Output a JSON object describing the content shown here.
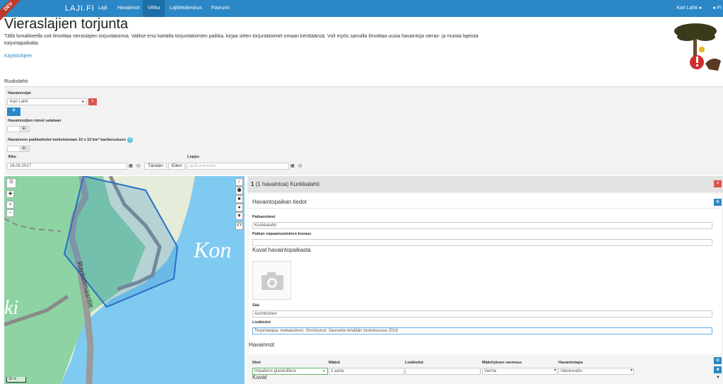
{
  "navbar": {
    "dev_label": "DEV",
    "brand": "LAJI.FI",
    "items": [
      {
        "label": "Lajit"
      },
      {
        "label": "Havainnot"
      },
      {
        "label": "Vihko"
      },
      {
        "label": "Lajitietokeskus"
      },
      {
        "label": "Foorumi"
      }
    ],
    "user": "Kari Lahti",
    "lang": "FI",
    "bg_color": "#2b87c6"
  },
  "page": {
    "title": "Vieraslajien torjunta",
    "intro": "Tällä lomakkeella voit ilmoittaa vieraslajien torjuntatoimia. Valitse ensi kartalta torjuntatoimien paikka, kirjaa sitten torjuntatoimet omaan kenttäänsä. Voit myös samalla ilmoittaa uusia havaintoja vieras- ja muista lajeista torjuntapaikalta.",
    "instructions_link": "Käyttöohjeet",
    "section": "Ruokolahti"
  },
  "form": {
    "observers_label": "Havainnoijat",
    "observer_value": "Kari Lahti",
    "hide_names_label": "Havainnoijien nimet salataan",
    "hide_names_value": "Ei",
    "coarse_label": "Havainnon paikkatiedot karkeistetaan 10 x 10 km² karttaruutuun",
    "coarse_value": "Ei",
    "start_label": "Alku",
    "start_value": "26.06.2017",
    "end_label": "Loppu",
    "end_placeholder": "pp.kk.vvvv tt.mm",
    "today_btn": "Tänään",
    "yesterday_btn": "Eilen"
  },
  "map": {
    "place_label": "Kon",
    "road_label": "Rantatimaantie",
    "left_label": "ki",
    "scale": "30 m",
    "xy": "XY"
  },
  "place_panel": {
    "header_count": "1",
    "header_rest": "(1 havaintoa) Kurikkalahti",
    "place_info_title": "Havaintopaikan tiedot",
    "place_names_label": "Paikannimet",
    "place_names_value": "Kurikkalahti",
    "place_desc_label": "Paikan vapaamuotoinen kuvaus",
    "place_desc_value": "",
    "images_title": "Kuvat havaintopaikasta",
    "weather_label": "Sää",
    "weather_value": "Aurinkoinen",
    "extra_label": "Lisätiedot",
    "extra_value": "Torjuntatapa: mekaaninen; Onnistunut; Seuranta tehdään toukokuussa 2018"
  },
  "observations": {
    "title": "Havainnot",
    "columns": [
      "Nimi",
      "Määrä",
      "Lisätiedot",
      "Määrityksen varmuus",
      "Havaintotapa"
    ],
    "row": {
      "name": "Impatiens glandulifera",
      "amount": "2 aaria",
      "notes": "",
      "certainty": "Varma",
      "method": "Valokuvattu"
    },
    "images_title": "Kuvat"
  }
}
